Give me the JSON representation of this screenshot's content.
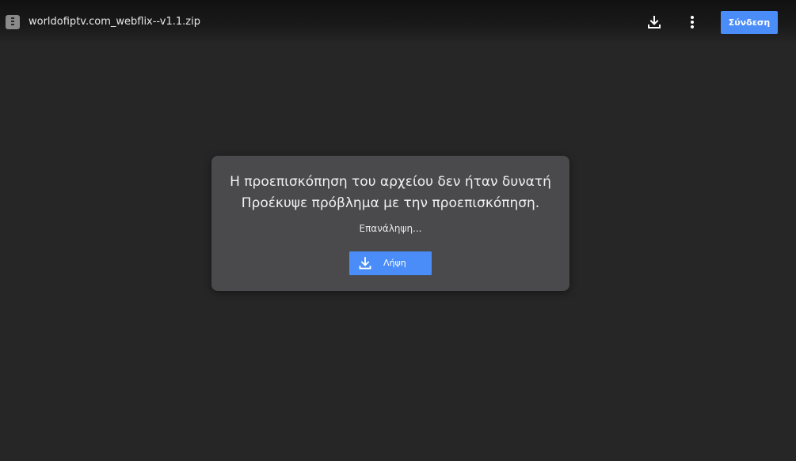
{
  "header": {
    "file_name": "worldofiptv.com_webflix--v1.1.zip",
    "file_icon": "zip-file-icon",
    "download_icon": "download-icon",
    "more_icon": "more-vert-icon",
    "sign_in_label": "Σύνδεση"
  },
  "dialog": {
    "title_line1": "Η προεπισκόπηση του αρχείου δεν ήταν δυνατή",
    "title_line2": "Προέκυψε πρόβλημα με την προεπισκόπηση.",
    "retry_label": "Επανάληψη...",
    "download_label": "Λήψη",
    "download_icon": "download-icon"
  },
  "colors": {
    "background": "#262626",
    "dialog_bg": "#4a494b",
    "accent": "#4b8df8"
  }
}
